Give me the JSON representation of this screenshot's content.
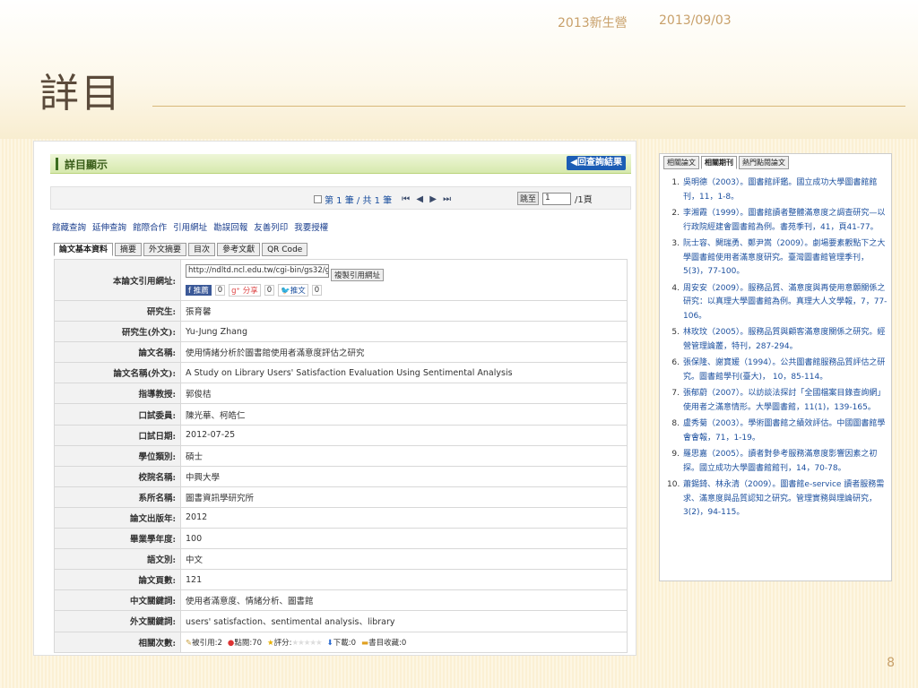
{
  "slide": {
    "header_left": "2013新生營",
    "header_date": "2013/09/03",
    "title": "詳目",
    "page_number": "8"
  },
  "detail": {
    "header_title": "詳目顯示",
    "back_label": "◀回查詢結果",
    "pager_text": "第 1 筆 / 共 1 筆",
    "pager_nav": "⏮ ◀ ▶ ⏭",
    "jump_label": "跳至",
    "jump_value": "1",
    "jump_total": "/1頁",
    "toolbar_links": [
      "館藏查詢",
      "延伸查詢",
      "館際合作",
      "引用網址",
      "勘誤回報",
      "友善列印",
      "我要授權"
    ],
    "tabs": [
      "論文基本資料",
      "摘要",
      "外文摘要",
      "目次",
      "參考文獻",
      "QR Code"
    ]
  },
  "record": {
    "url_label": "本論文引用網址:",
    "url_value": "http://ndltd.ncl.edu.tw/cgi-bin/gs32/gs",
    "copy_button": "複製引用網址",
    "fb_label": "推薦",
    "fb_count": "0",
    "gplus_label": "分享",
    "gplus_count": "0",
    "tw_label": "推文",
    "tw_count": "0",
    "rows": [
      {
        "label": "研究生:",
        "value": "張育馨"
      },
      {
        "label": "研究生(外文):",
        "value": "Yu-Jung Zhang"
      },
      {
        "label": "論文名稱:",
        "value": "使用情緒分析於圖書館使用者滿意度評估之研究"
      },
      {
        "label": "論文名稱(外文):",
        "value": "A Study on Library Users' Satisfaction Evaluation Using Sentimental Analysis"
      },
      {
        "label": "指導教授:",
        "value": "郭俊桔"
      },
      {
        "label": "口試委員:",
        "value": "陳光華、柯皓仁"
      },
      {
        "label": "口試日期:",
        "value": "2012-07-25"
      },
      {
        "label": "學位類別:",
        "value": "碩士"
      },
      {
        "label": "校院名稱:",
        "value": "中興大學"
      },
      {
        "label": "系所名稱:",
        "value": "圖書資訊學研究所"
      },
      {
        "label": "論文出版年:",
        "value": "2012"
      },
      {
        "label": "畢業學年度:",
        "value": "100"
      },
      {
        "label": "語文別:",
        "value": "中文"
      },
      {
        "label": "論文頁數:",
        "value": "121"
      },
      {
        "label": "中文關鍵詞:",
        "value": "使用者滿意度、情緒分析、圖書館"
      },
      {
        "label": "外文關鍵詞:",
        "value": "users' satisfaction、sentimental analysis、library"
      }
    ],
    "stats_label": "相關次數:",
    "stats": {
      "cited": "被引用:2",
      "views": "點閱:70",
      "rating": "評分:",
      "downloads": "下載:0",
      "bookmarks": "書目收藏:0"
    }
  },
  "related": {
    "tabs": [
      "相關論文",
      "相關期刊",
      "熱門點閱論文"
    ],
    "items": [
      "吳明德（2003）。圖書館評鑑。國立成功大學圖書館館刊，11，1-8。",
      "李湘霞（1999）。圖書館讀者整體滿意度之調查研究—以行政院經建會圖書館為例。書苑季刊，41，頁41-77。",
      "阮士容、闕瑞勇、鄭尹嵩（2009）。劇場要素觀點下之大學圖書館使用者滿意度研究。臺灣圖書館管理季刊，5(3)，77-100。",
      "周安安（2009）。服務品質、滿意度與再使用意願關係之研究：以真理大學圖書館為例。真理大人文學報，7，77-106。",
      "林玫玟（2005）。服務品質與顧客滿意度關係之研究。經營管理論叢，特刊，287-294。",
      "張保隆、謝寶媛（1994）。公共圖書館服務品質評估之研究。圖書館學刊(臺大)， 10，85-114。",
      "張郁蔚（2007）。以訪談法探討「全國檔案目錄查詢網」使用者之滿意情形。大學圖書館，11(1)，139-165。",
      "盧秀菊（2003）。學術圖書館之績效評估。中國圖書館學會會報，71，1-19。",
      "羅思嘉（2005）。讀者對參考服務滿意度影響因素之初探。國立成功大學圖書館館刊，14，70-78。",
      "蕭錫錡、林永清（2009）。圖書館e-service 讀者服務需求、滿意度與品質認知之研究。管理實務與理論研究，3(2)，94-115。"
    ]
  }
}
